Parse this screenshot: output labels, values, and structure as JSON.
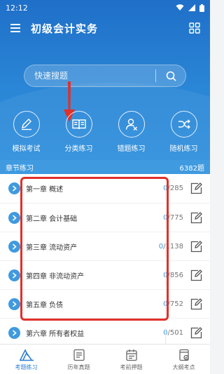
{
  "status": {
    "time": "12:12"
  },
  "header": {
    "title": "初级会计实务"
  },
  "search": {
    "placeholder": "快速搜题"
  },
  "actions": [
    {
      "label": "模拟考试",
      "icon": "pencil-icon"
    },
    {
      "label": "分类练习",
      "icon": "book-icon"
    },
    {
      "label": "错题练习",
      "icon": "user-x-icon"
    },
    {
      "label": "随机练习",
      "icon": "shuffle-icon"
    }
  ],
  "section": {
    "title": "章节练习",
    "count": "6382题"
  },
  "chapters": [
    {
      "title": "第一章 概述",
      "done": "0",
      "total": "285"
    },
    {
      "title": "第二章 会计基础",
      "done": "0",
      "total": "775"
    },
    {
      "title": "第三章 流动资产",
      "done": "0",
      "total": "1138"
    },
    {
      "title": "第四章 非流动资产",
      "done": "0",
      "total": "856"
    },
    {
      "title": "第五章 负债",
      "done": "0",
      "total": "752"
    },
    {
      "title": "第六章 所有者权益",
      "done": "0",
      "total": "501"
    }
  ],
  "tabs": [
    {
      "label": "考题练习",
      "icon": "practice-icon",
      "active": true
    },
    {
      "label": "历年真题",
      "icon": "papers-icon",
      "active": false
    },
    {
      "label": "考前押题",
      "icon": "calendar-icon",
      "active": false
    },
    {
      "label": "大纲考点",
      "icon": "outline-icon",
      "active": false
    }
  ],
  "colors": {
    "primary": "#2b7fd3",
    "accent_bar": "#3f9ae0",
    "annotation": "#e0302a"
  }
}
